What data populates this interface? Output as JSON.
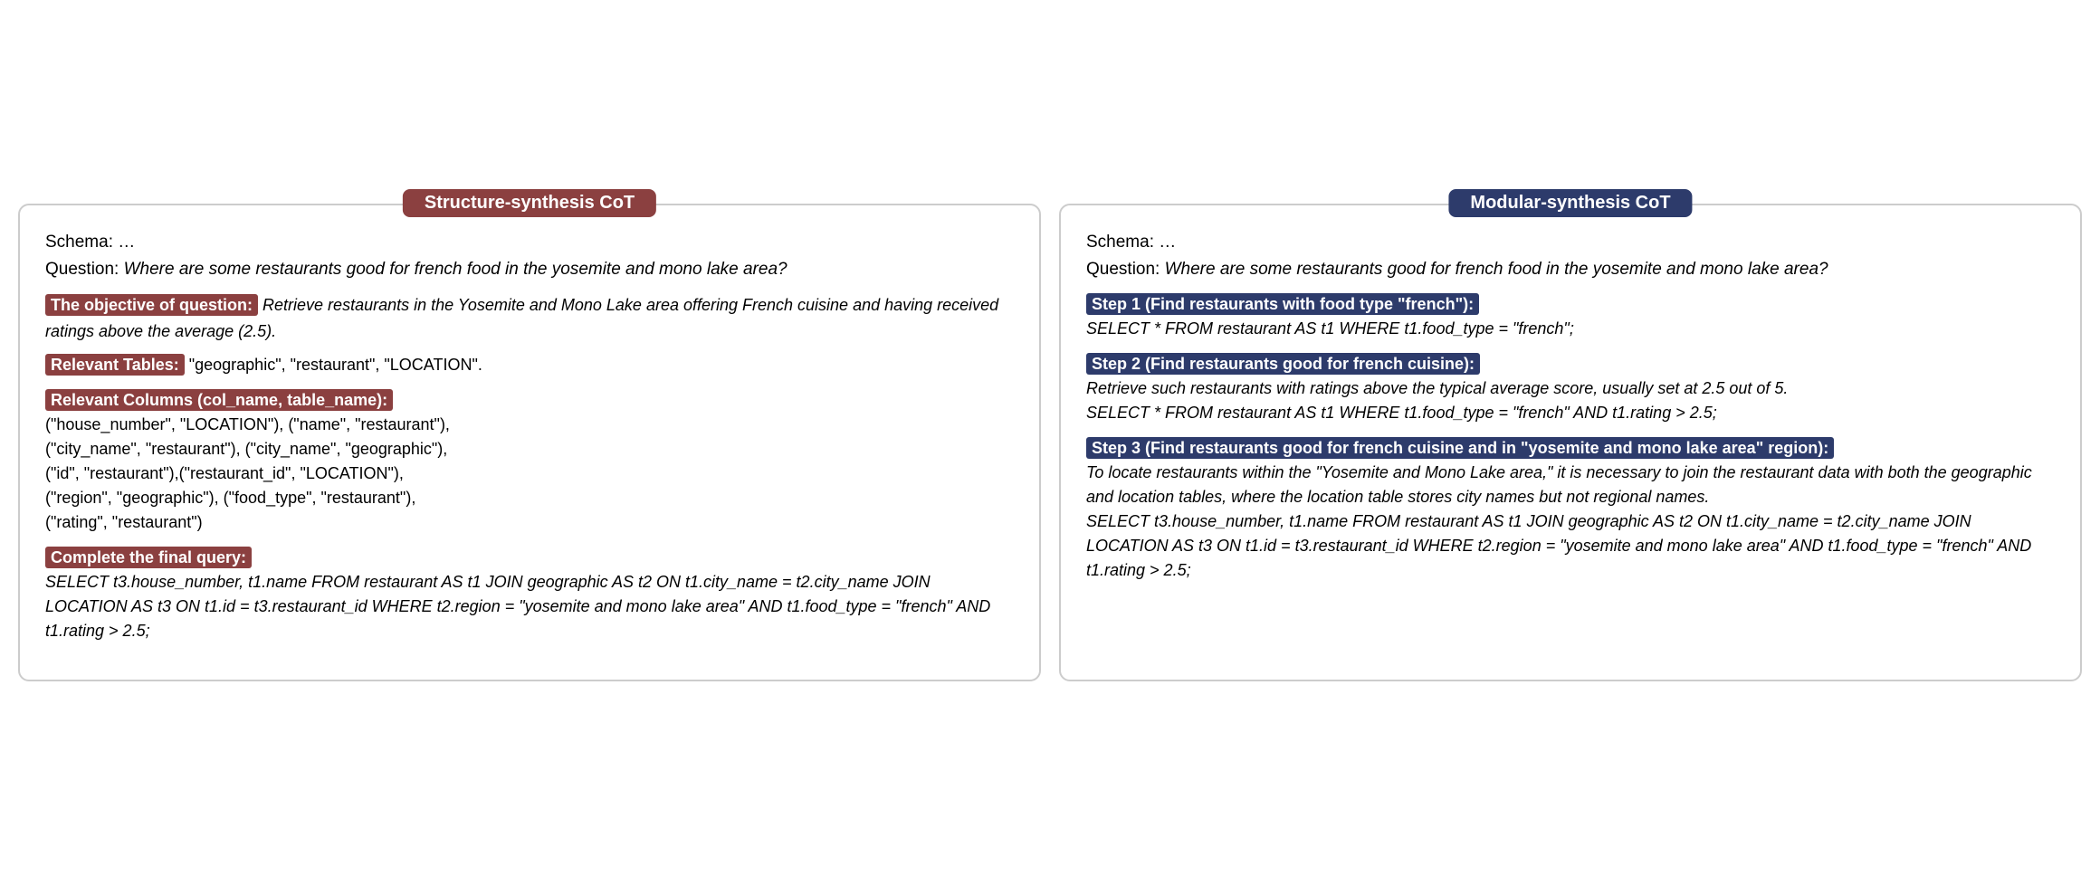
{
  "left_panel": {
    "title": "Structure-synthesis CoT",
    "schema": "Schema: …",
    "question_prefix": "Question: ",
    "question_text": "Where are some restaurants good for french food in the yosemite and mono lake area?",
    "objective_label": "The objective of question:",
    "objective_text": "Retrieve restaurants in the Yosemite and Mono Lake area offering French cuisine and having received ratings above the average (2.5).",
    "tables_label": "Relevant Tables:",
    "tables_text": "\"geographic\", \"restaurant\", \"LOCATION\".",
    "columns_label": "Relevant Columns (col_name, table_name):",
    "columns_text": "(\"house_number\", \"LOCATION\"), (\"name\", \"restaurant\"),\n(\"city_name\", \"restaurant\"), (\"city_name\", \"geographic\"),\n(\"id\", \"restaurant\"),(\"restaurant_id\", \"LOCATION\"),\n(\"region\", \"geographic\"), (\"food_type\", \"restaurant\"),\n(\"rating\", \"restaurant\")",
    "query_label": "Complete the final query:",
    "query_text": "SELECT t3.house_number,  t1.name FROM restaurant AS t1 JOIN geographic AS t2 ON t1.city_name  =  t2.city_name JOIN LOCATION AS t3 ON t1.id  =  t3.restaurant_id WHERE t2.region  =  \"yosemite and mono lake area\" AND t1.food_type  =  \"french\" AND t1.rating  >  2.5;"
  },
  "right_panel": {
    "title": "Modular-synthesis CoT",
    "schema": "Schema: …",
    "question_prefix": "Question: ",
    "question_text": "Where are some restaurants good for french food in the yosemite and mono lake area?",
    "step1_label": "Step 1 (Find restaurants with food type \"french\"):",
    "step1_text": "SELECT * FROM restaurant AS t1 WHERE t1.food_type  =  \"french\";",
    "step2_label": "Step 2 (Find restaurants good for french cuisine):",
    "step2_text": "Retrieve such restaurants with ratings above the typical average score, usually set at 2.5 out of 5.\nSELECT * FROM restaurant AS t1 WHERE t1.food_type  =  \"french\" AND t1.rating > 2.5;",
    "step3_label": "Step 3 (Find restaurants good for french cuisine and in \"yosemite and mono lake area\" region):",
    "step3_text": "To locate restaurants within the \"Yosemite and Mono Lake area,\" it is necessary to join the restaurant data with both the geographic and location tables, where the location table stores city names but not regional names.\nSELECT t3.house_number,  t1.name FROM restaurant AS t1 JOIN geographic AS t2 ON t1.city_name  =  t2.city_name JOIN LOCATION AS t3 ON t1.id  =  t3.restaurant_id WHERE t2.region  =  \"yosemite and mono lake area\" AND t1.food_type  =  \"french\" AND t1.rating  >  2.5;"
  }
}
